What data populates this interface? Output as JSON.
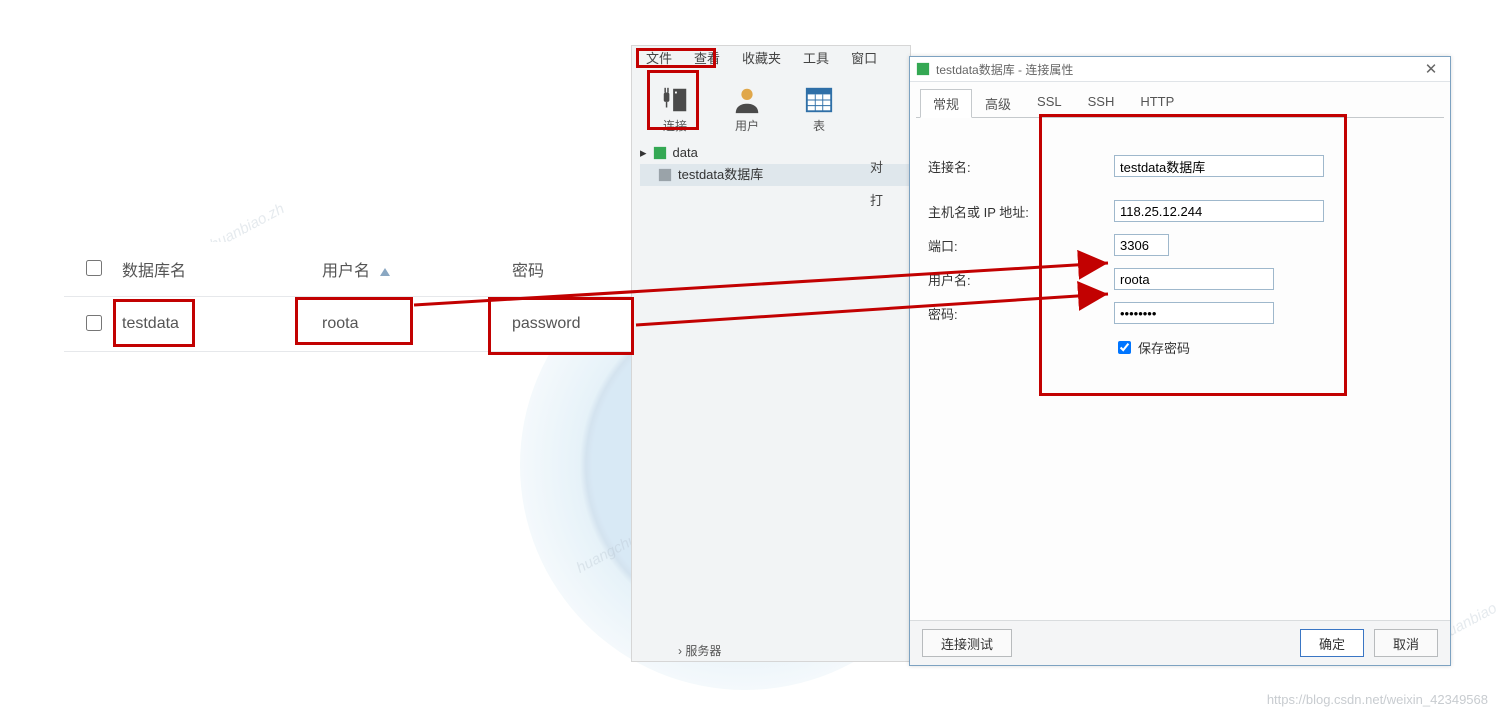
{
  "table": {
    "headers": {
      "dbname": "数据库名",
      "username": "用户名",
      "password": "密码"
    },
    "row": {
      "dbname": "testdata",
      "username": "roota",
      "password": "password"
    }
  },
  "menubar": {
    "file": "文件",
    "view": "查看",
    "fav": "收藏夹",
    "tool": "工具",
    "window": "窗口"
  },
  "toolbar": {
    "connect": "连接",
    "user": "用户",
    "table": "表"
  },
  "tree": {
    "item1": "data",
    "item2": "testdata数据库"
  },
  "cruft": {
    "obj": "对",
    "opentable": "打"
  },
  "servers_label": "服务器",
  "dialog": {
    "title": "testdata数据库 - 连接属性",
    "tabs": {
      "general": "常规",
      "advanced": "高级",
      "ssl": "SSL",
      "ssh": "SSH",
      "http": "HTTP"
    },
    "labels": {
      "name": "连接名:",
      "host": "主机名或 IP 地址:",
      "port": "端口:",
      "user": "用户名:",
      "pwd": "密码:",
      "savepwd": "保存密码"
    },
    "values": {
      "name": "testdata数据库",
      "host": "118.25.12.244",
      "port": "3306",
      "user": "roota",
      "pwd": "••••••••"
    },
    "buttons": {
      "test": "连接测试",
      "ok": "确定",
      "cancel": "取消"
    }
  },
  "watermark": "huangchuanbiao.zh",
  "footer": "https://blog.csdn.net/weixin_42349568"
}
